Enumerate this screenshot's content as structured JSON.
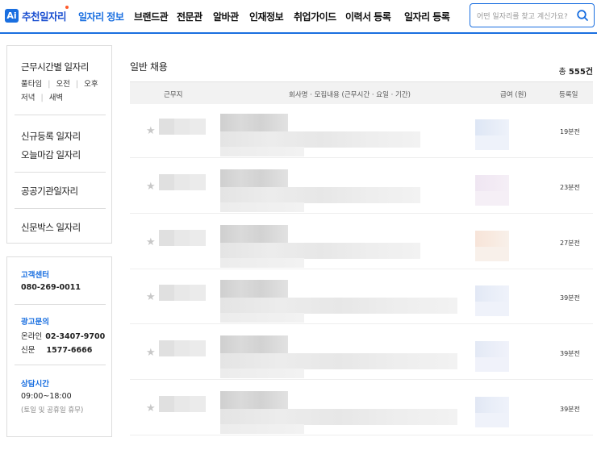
{
  "header": {
    "logo_badge": "Ai",
    "logo_text": "추천일자리",
    "nav": [
      {
        "label": "일자리 정보",
        "active": true
      },
      {
        "label": "브랜드관",
        "active": false
      },
      {
        "label": "전문관",
        "active": false
      },
      {
        "label": "알바관",
        "active": false
      },
      {
        "label": "인재정보",
        "active": false
      },
      {
        "label": "취업가이드",
        "active": false
      },
      {
        "label": "이력서 등록",
        "active": false
      },
      {
        "label": "일자리 등록",
        "active": false
      }
    ],
    "search_placeholder": "어떤 일자리를 찾고 계신가요?",
    "accent_color": "#1a6fe0"
  },
  "sidebar": {
    "worktime_title": "근무시간별 일자리",
    "worktime_options": [
      "풀타임",
      "오전",
      "오후",
      "저녁",
      "새벽"
    ],
    "menu": [
      "신규등록 일자리",
      "오늘마감 일자리",
      "공공기관일자리",
      "신문박스 일자리"
    ],
    "support": {
      "cs_title": "고객센터",
      "cs_phone": "080-269-0011",
      "ad_title": "광고문의",
      "ad_online_label": "온라인",
      "ad_online_phone": "02-3407-9700",
      "ad_paper_label": "신문",
      "ad_paper_phone": "1577-6666",
      "hours_title": "상담시간",
      "hours": "09:00~18:00",
      "hours_note": "(토일 및 공휴일 휴무)"
    }
  },
  "main": {
    "title": "일반 채용",
    "total_prefix": "총",
    "total_count": "555건",
    "columns": [
      "근무지",
      "회사명 · 모집내용 (근무시간 · 요일 · 기간)",
      "급여 (원)",
      "등록일"
    ],
    "rows": [
      {
        "posted": "19분전"
      },
      {
        "posted": "23분전"
      },
      {
        "posted": "27분전"
      },
      {
        "posted": "39분전"
      },
      {
        "posted": "39분전"
      },
      {
        "posted": "39분전"
      }
    ]
  }
}
